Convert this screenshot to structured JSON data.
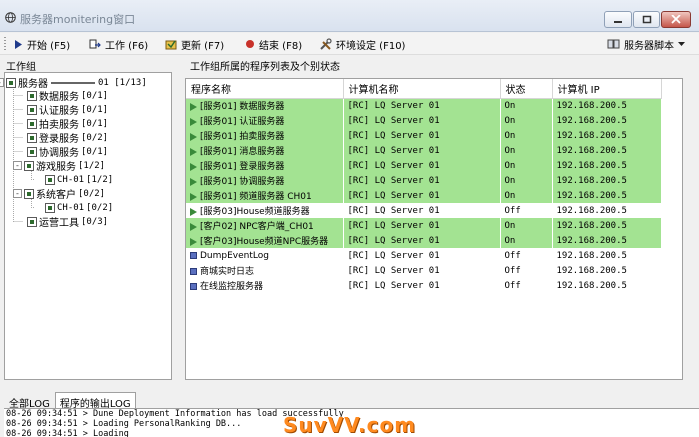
{
  "window": {
    "title": "服务器monitering窗口"
  },
  "toolbar": {
    "start": "开始 (F5)",
    "work": "工作 (F6)",
    "update": "更新 (F7)",
    "end": "结束 (F8)",
    "settings": "环境设定 (F10)",
    "script": "服务器脚本"
  },
  "left": {
    "title": "工作组",
    "tree": [
      {
        "label": "服务器",
        "suffix": "01 [1/13]",
        "level": 0,
        "toggle": "-"
      },
      {
        "label": "数据服务",
        "suffix": "[0/1]",
        "level": 1
      },
      {
        "label": "认证服务",
        "suffix": "[0/1]",
        "level": 1
      },
      {
        "label": "拍卖服务",
        "suffix": "[0/1]",
        "level": 1
      },
      {
        "label": "登录服务",
        "suffix": "[0/2]",
        "level": 1
      },
      {
        "label": "协调服务",
        "suffix": "[0/1]",
        "level": 1
      },
      {
        "label": "游戏服务",
        "suffix": "[1/2]",
        "level": 1,
        "toggle": "-"
      },
      {
        "label": "CH-01",
        "suffix": "[1/2]",
        "level": 2
      },
      {
        "label": "系统客户",
        "suffix": "[0/2]",
        "level": 1,
        "toggle": "-"
      },
      {
        "label": "CH-01",
        "suffix": "[0/2]",
        "level": 2
      },
      {
        "label": "运营工具",
        "suffix": "[0/3]",
        "level": 1
      }
    ]
  },
  "right": {
    "title": "工作组所属的程序列表及个别状态",
    "columns": [
      "程序名称",
      "计算机名称",
      "状态",
      "计算机 IP"
    ],
    "rows": [
      {
        "name": "[服务01] 数据服务器",
        "computer": "[RC] LQ Server 01",
        "status": "On",
        "ip": "192.168.200.5",
        "green": true,
        "icon": "play"
      },
      {
        "name": "[服务01] 认证服务器",
        "computer": "[RC] LQ Server 01",
        "status": "On",
        "ip": "192.168.200.5",
        "green": true,
        "icon": "play"
      },
      {
        "name": "[服务01] 拍卖服务器",
        "computer": "[RC] LQ Server 01",
        "status": "On",
        "ip": "192.168.200.5",
        "green": true,
        "icon": "play"
      },
      {
        "name": "[服务01] 消息服务器",
        "computer": "[RC] LQ Server 01",
        "status": "On",
        "ip": "192.168.200.5",
        "green": true,
        "icon": "play"
      },
      {
        "name": "[服务01] 登录服务器",
        "computer": "[RC] LQ Server 01",
        "status": "On",
        "ip": "192.168.200.5",
        "green": true,
        "icon": "play"
      },
      {
        "name": "[服务01] 协调服务器",
        "computer": "[RC] LQ Server 01",
        "status": "On",
        "ip": "192.168.200.5",
        "green": true,
        "icon": "play"
      },
      {
        "name": "[服务01] 频道服务器 CH01",
        "computer": "[RC] LQ Server 01",
        "status": "On",
        "ip": "192.168.200.5",
        "green": true,
        "icon": "play"
      },
      {
        "name": "[服务03]House频道服务器",
        "computer": "[RC] LQ Server 01",
        "status": "Off",
        "ip": "192.168.200.5",
        "green": false,
        "icon": "play"
      },
      {
        "name": "[客户02] NPC客户端_CH01",
        "computer": "[RC] LQ Server 01",
        "status": "On",
        "ip": "192.168.200.5",
        "green": true,
        "icon": "play"
      },
      {
        "name": "[客户03]House频道NPC服务器",
        "computer": "[RC] LQ Server 01",
        "status": "On",
        "ip": "192.168.200.5",
        "green": true,
        "icon": "play"
      },
      {
        "name": "DumpEventLog",
        "computer": "[RC] LQ Server 01",
        "status": "Off",
        "ip": "192.168.200.5",
        "green": false,
        "icon": "square"
      },
      {
        "name": "商城实时日志",
        "computer": "[RC] LQ Server 01",
        "status": "Off",
        "ip": "192.168.200.5",
        "green": false,
        "icon": "square"
      },
      {
        "name": "在线监控服务器",
        "computer": "[RC] LQ Server 01",
        "status": "Off",
        "ip": "192.168.200.5",
        "green": false,
        "icon": "square"
      }
    ]
  },
  "log": {
    "tabs": [
      "全部LOG",
      "程序的输出LOG"
    ],
    "active_tab": 1,
    "lines": [
      "08-26 09:34:51 > Dune Deployment Information has load successfully",
      "08-26 09:34:51 > Loading PersonalRanking DB...",
      "08-26 09:34:51 > Loading"
    ]
  },
  "watermark": "SuvVV.com",
  "colors": {
    "running_row": "#a3e392",
    "play_icon": "#3a8a3a",
    "stop_icon": "#5a6fbf"
  }
}
